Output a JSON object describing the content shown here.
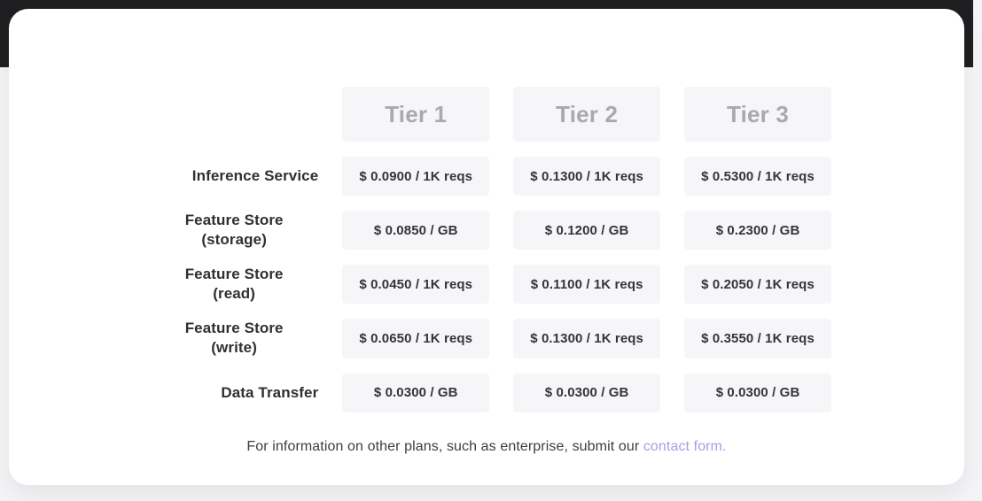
{
  "theme": {
    "backdrop_color": "#1f1f21",
    "card_color": "#ffffff",
    "page_background": "#f4f4f6",
    "cell_background": "#f6f6f8",
    "header_text_color": "#a9a9ae",
    "label_text_color": "#2f3033",
    "link_color": "#a3a0e6"
  },
  "table": {
    "columns": [
      {
        "label": "Tier 1"
      },
      {
        "label": "Tier 2"
      },
      {
        "label": "Tier 3"
      }
    ],
    "rows": [
      {
        "label": "Inference Service",
        "label_lines": [
          "Inference Service"
        ],
        "values": [
          "$ 0.0900 / 1K reqs",
          "$ 0.1300 / 1K reqs",
          "$ 0.5300 / 1K reqs"
        ]
      },
      {
        "label": "Feature Store (storage)",
        "label_lines": [
          "Feature Store",
          "(storage)"
        ],
        "values": [
          "$ 0.0850 / GB",
          "$ 0.1200 / GB",
          "$ 0.2300 / GB"
        ]
      },
      {
        "label": "Feature Store (read)",
        "label_lines": [
          "Feature Store",
          "(read)"
        ],
        "values": [
          "$ 0.0450 / 1K reqs",
          "$ 0.1100 / 1K reqs",
          "$ 0.2050 / 1K reqs"
        ]
      },
      {
        "label": "Feature Store (write)",
        "label_lines": [
          "Feature Store",
          "(write)"
        ],
        "values": [
          "$ 0.0650 / 1K reqs",
          "$ 0.1300 / 1K reqs",
          "$ 0.3550 / 1K reqs"
        ]
      },
      {
        "label": "Data Transfer",
        "label_lines": [
          "Data Transfer"
        ],
        "values": [
          "$ 0.0300 / GB",
          "$ 0.0300 / GB",
          "$ 0.0300 / GB"
        ]
      }
    ]
  },
  "footer": {
    "text_before": "For information on other plans, such as enterprise, submit our",
    "link_label": "contact form."
  }
}
